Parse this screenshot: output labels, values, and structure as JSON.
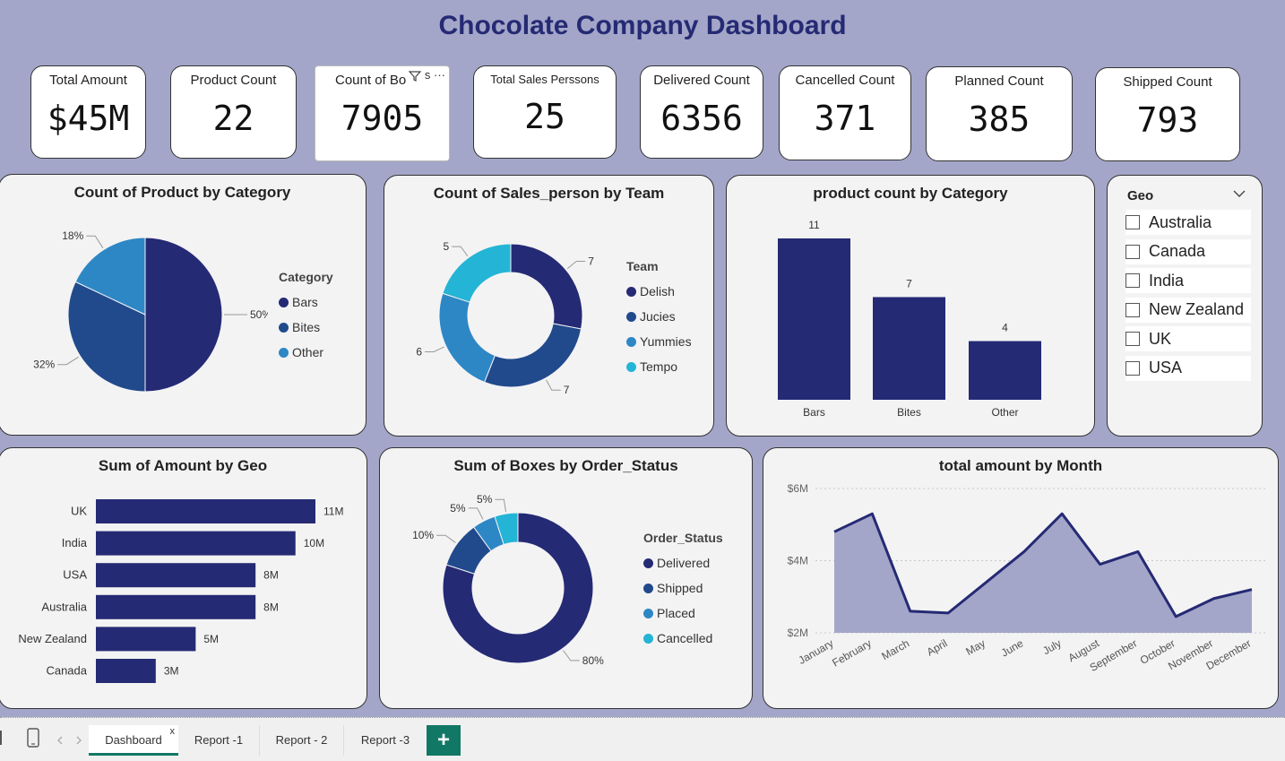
{
  "title": "Chocolate Company Dashboard",
  "colors": {
    "dark": "#252a74",
    "mid": "#214a8c",
    "blue": "#2e87c5",
    "cyan": "#24b4d6",
    "area": "#a3a6c8"
  },
  "kpis": [
    {
      "label": "Total Amount",
      "value": "$45M"
    },
    {
      "label": "Product Count",
      "value": "22"
    },
    {
      "label": "Count of Bo",
      "value": "7905"
    },
    {
      "label": "Total Sales Perssons",
      "value": "25"
    },
    {
      "label": "Delivered Count",
      "value": "6356"
    },
    {
      "label": "Cancelled Count",
      "value": "371"
    },
    {
      "label": "Planned Count",
      "value": "385"
    },
    {
      "label": "Shipped Count",
      "value": "793"
    }
  ],
  "kpi_tools": {
    "filter_icon": "filter-icon",
    "more_icon": "more-options-icon",
    "suffix": "s",
    "more": "···"
  },
  "pie_category": {
    "title": "Count of Product by Category",
    "legend_title": "Category",
    "chart_data": {
      "type": "pie",
      "categories": [
        "Bars",
        "Bites",
        "Other"
      ],
      "values": [
        50,
        32,
        18
      ],
      "labels": [
        "50%",
        "32%",
        "18%"
      ],
      "colors": [
        "#252a74",
        "#214a8c",
        "#2e87c5"
      ]
    }
  },
  "donut_team": {
    "title": "Count of Sales_person by Team",
    "legend_title": "Team",
    "chart_data": {
      "type": "pie",
      "categories": [
        "Delish",
        "Jucies",
        "Yummies",
        "Tempo"
      ],
      "values": [
        7,
        7,
        6,
        5
      ],
      "labels": [
        "7",
        "7",
        "6",
        "5"
      ],
      "colors": [
        "#252a74",
        "#214a8c",
        "#2e87c5",
        "#24b4d6"
      ]
    }
  },
  "bar_category": {
    "title": "product count by Category",
    "chart_data": {
      "type": "bar",
      "categories": [
        "Bars",
        "Bites",
        "Other"
      ],
      "values": [
        11,
        7,
        4
      ],
      "labels": [
        "11",
        "7",
        "4"
      ],
      "ylim": [
        0,
        11
      ]
    }
  },
  "geo": {
    "title": "Geo",
    "items": [
      "Australia",
      "Canada",
      "India",
      "New Zealand",
      "UK",
      "USA"
    ]
  },
  "bar_geo": {
    "title": "Sum of Amount by Geo",
    "chart_data": {
      "type": "bar",
      "categories": [
        "UK",
        "India",
        "USA",
        "Australia",
        "New Zealand",
        "Canada"
      ],
      "values": [
        11,
        10,
        8,
        8,
        5,
        3
      ],
      "labels": [
        "11M",
        "10M",
        "8M",
        "8M",
        "5M",
        "3M"
      ],
      "unit": "M"
    }
  },
  "donut_status": {
    "title": "Sum of Boxes by Order_Status",
    "legend_title": "Order_Status",
    "chart_data": {
      "type": "pie",
      "categories": [
        "Delivered",
        "Shipped",
        "Placed",
        "Cancelled"
      ],
      "values": [
        80,
        10,
        5,
        5
      ],
      "labels": [
        "80%",
        "10%",
        "5%",
        "5%"
      ],
      "colors": [
        "#252a74",
        "#214a8c",
        "#2e87c5",
        "#24b4d6"
      ]
    }
  },
  "line_month": {
    "title": "total amount by Month",
    "chart_data": {
      "type": "area",
      "categories": [
        "January",
        "February",
        "March",
        "April",
        "May",
        "June",
        "July",
        "August",
        "September",
        "October",
        "November",
        "December"
      ],
      "values": [
        4.8,
        5.3,
        2.6,
        2.55,
        3.4,
        4.25,
        5.3,
        3.9,
        4.25,
        2.45,
        2.95,
        3.2
      ],
      "unit": "M",
      "ylim": [
        2,
        6
      ],
      "yticks": [
        "$2M",
        "$4M",
        "$6M"
      ],
      "grid": true
    }
  },
  "tabs": [
    "Dashboard",
    "Report -1",
    "Report - 2",
    "Report -3"
  ],
  "tab_close": "x",
  "tab_add": "+"
}
